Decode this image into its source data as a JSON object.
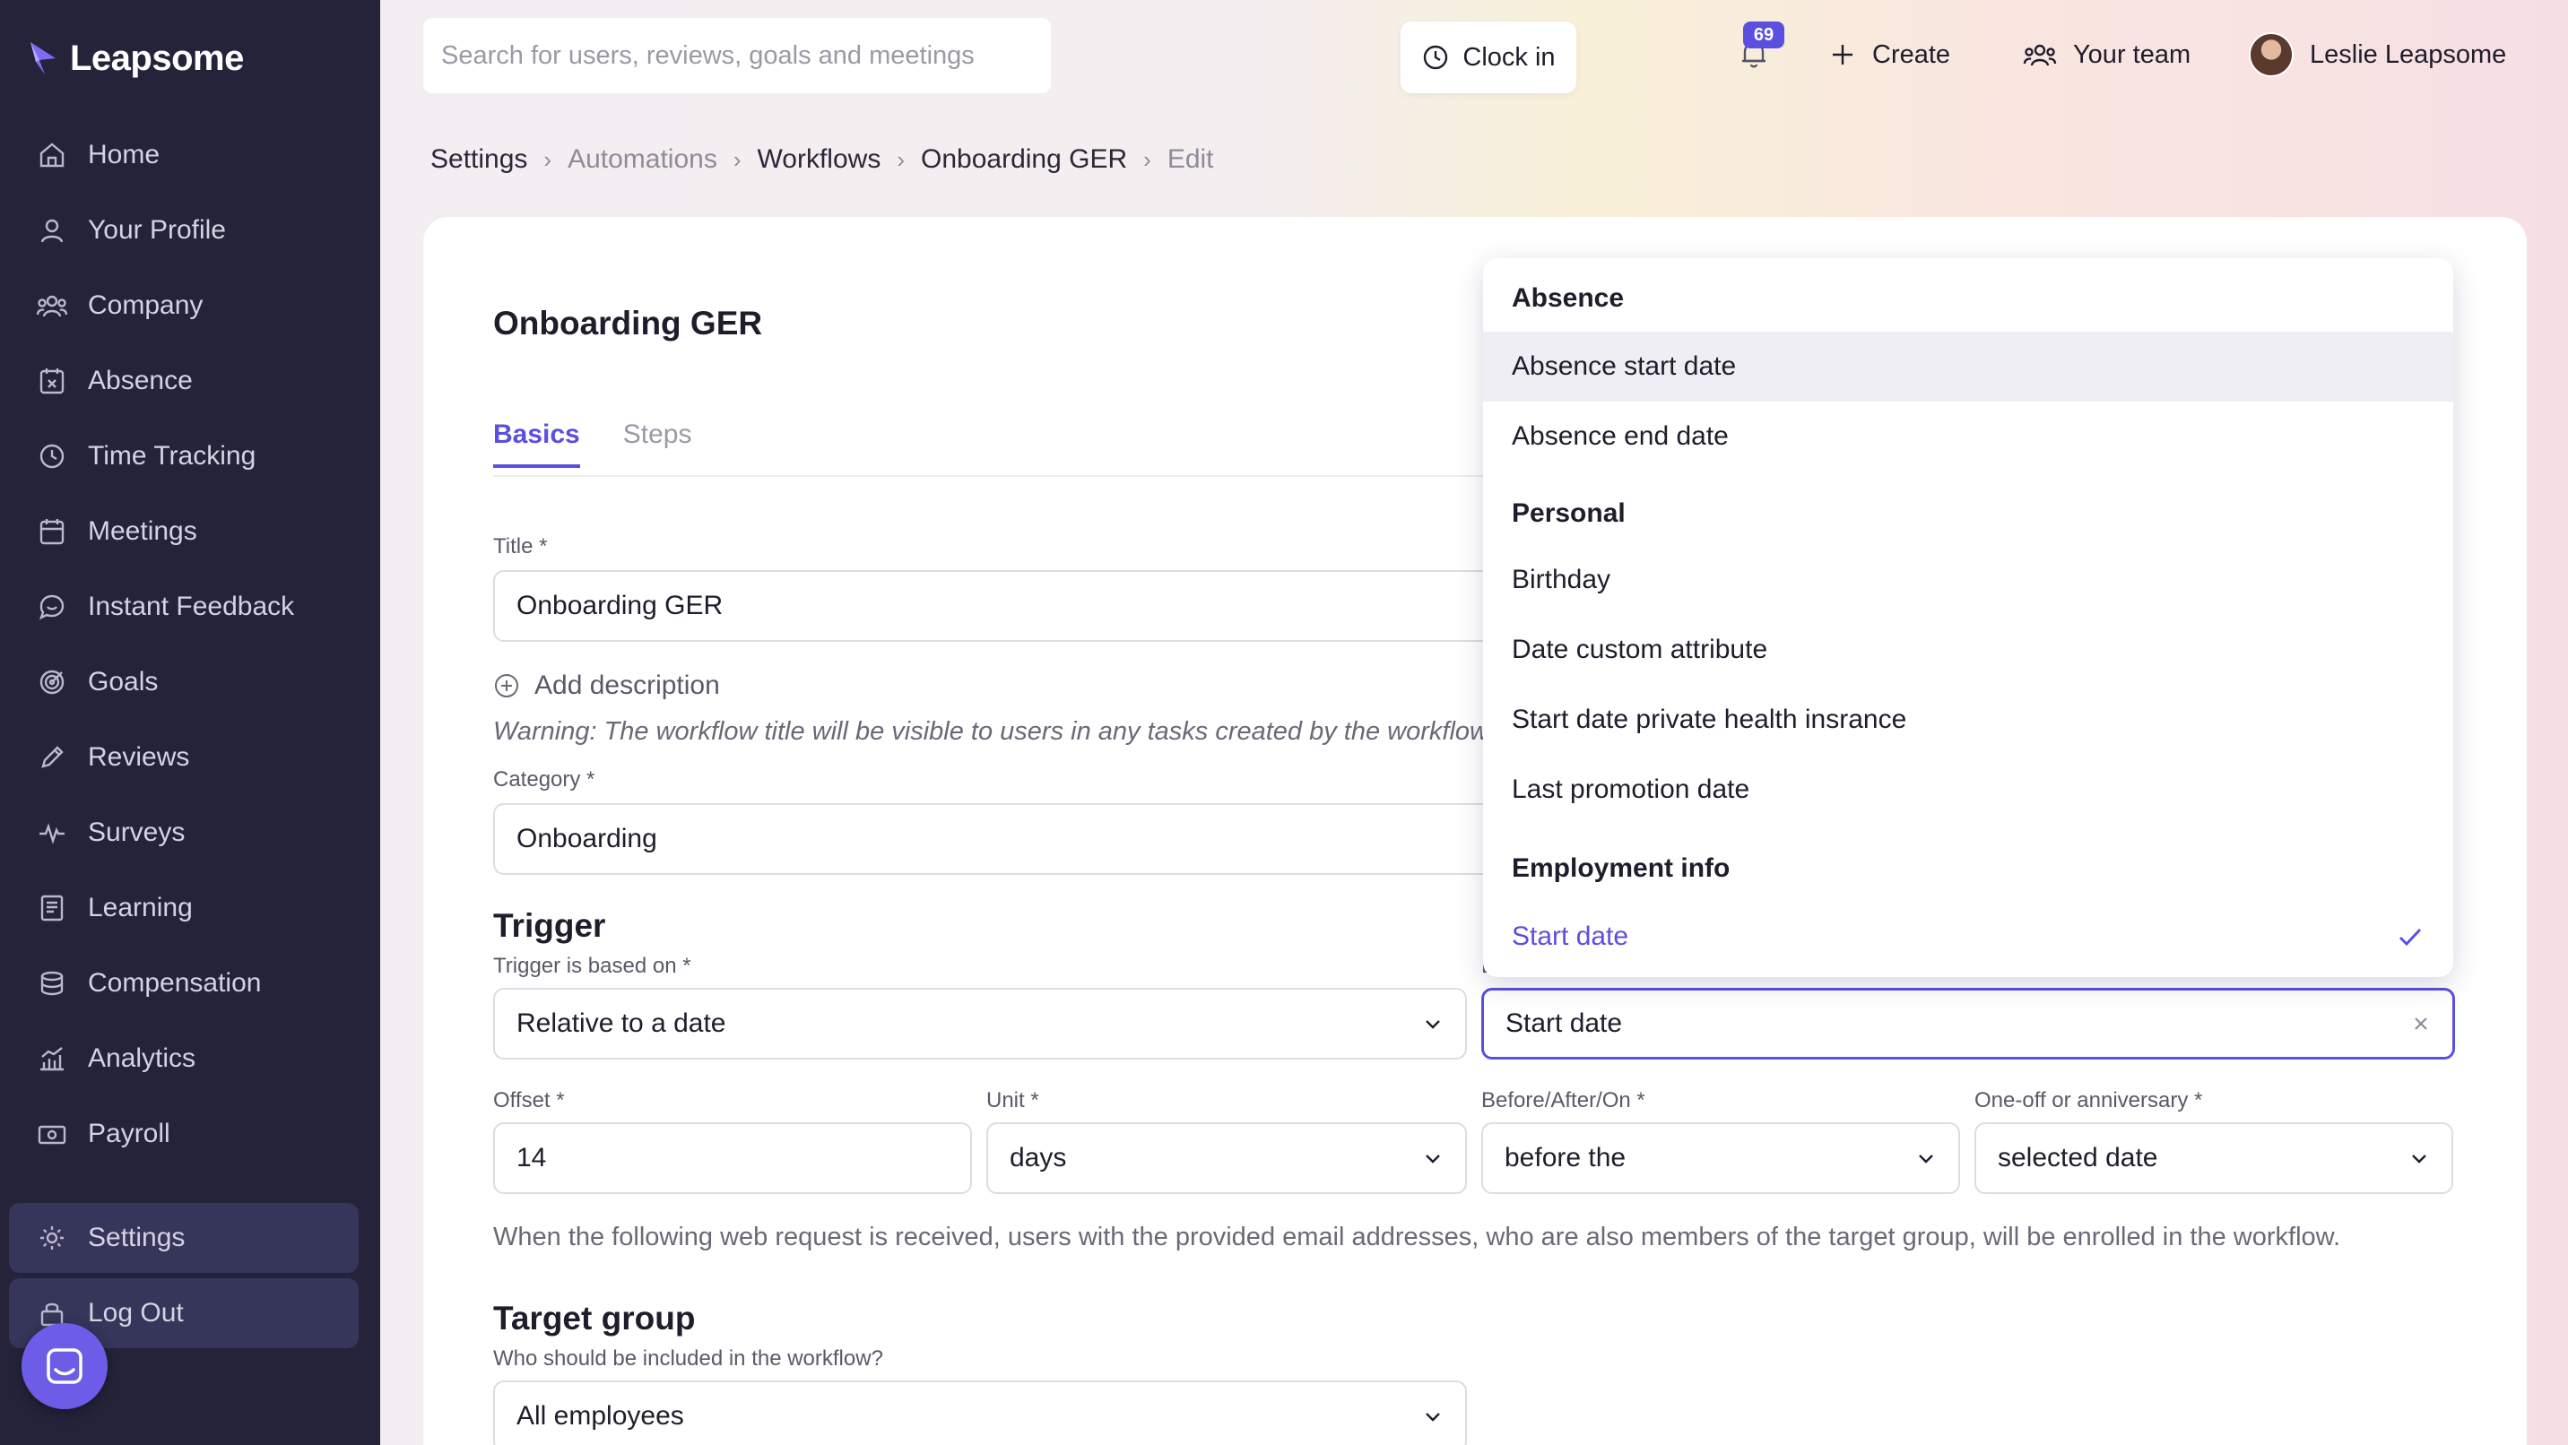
{
  "app": {
    "brand": "Leapsome"
  },
  "sidebar": {
    "items": [
      {
        "label": "Home",
        "icon": "home-icon"
      },
      {
        "label": "Your Profile",
        "icon": "user-icon"
      },
      {
        "label": "Company",
        "icon": "people-icon"
      },
      {
        "label": "Absence",
        "icon": "calendar-x-icon"
      },
      {
        "label": "Time Tracking",
        "icon": "clock-icon"
      },
      {
        "label": "Meetings",
        "icon": "calendar-icon"
      },
      {
        "label": "Instant Feedback",
        "icon": "chat-icon"
      },
      {
        "label": "Goals",
        "icon": "target-icon"
      },
      {
        "label": "Reviews",
        "icon": "pencil-icon"
      },
      {
        "label": "Surveys",
        "icon": "pulse-icon"
      },
      {
        "label": "Learning",
        "icon": "book-icon"
      },
      {
        "label": "Compensation",
        "icon": "coins-icon"
      },
      {
        "label": "Analytics",
        "icon": "chart-icon"
      },
      {
        "label": "Payroll",
        "icon": "cash-icon"
      }
    ],
    "bottom": [
      {
        "label": "Settings",
        "icon": "gear-icon"
      },
      {
        "label": "Log Out",
        "icon": "lock-icon"
      }
    ]
  },
  "topbar": {
    "search_placeholder": "Search for users, reviews, goals and meetings",
    "clock_in": "Clock in",
    "notifications_count": "69",
    "create": "Create",
    "your_team": "Your team",
    "user_name": "Leslie Leapsome"
  },
  "breadcrumb": [
    "Settings",
    "Automations",
    "Workflows",
    "Onboarding GER",
    "Edit"
  ],
  "page": {
    "title": "Onboarding GER",
    "tabs": [
      "Basics",
      "Steps"
    ],
    "title_label": "Title *",
    "title_value": "Onboarding GER",
    "add_description": "Add description",
    "warning": "Warning: The workflow title will be visible to users in any tasks created by the workflow.",
    "category_label": "Category *",
    "category_value": "Onboarding",
    "trigger_title": "Trigger",
    "trigger_label": "Trigger is based on *",
    "trigger_value": "Relative to a date",
    "date_field_label_fragment": "L",
    "date_value": "Start date",
    "offset_label": "Offset *",
    "offset_value": "14",
    "unit_label": "Unit *",
    "unit_value": "days",
    "before_after_label": "Before/After/On *",
    "before_after_value": "before the",
    "oneoff_label": "One-off or anniversary *",
    "oneoff_value": "selected date",
    "info_text": "When the following web request is received, users with the provided email addresses, who are also members of the target group, will be enrolled in the workflow.",
    "target_group_title": "Target group",
    "target_group_label": "Who should be included in the workflow?",
    "target_group_value": "All employees"
  },
  "dropdown": {
    "groups": [
      {
        "name": "Absence",
        "options": [
          "Absence start date",
          "Absence end date"
        ]
      },
      {
        "name": "Personal",
        "options": [
          "Birthday",
          "Date custom attribute",
          "Start date private health insrance",
          "Last promotion date"
        ]
      },
      {
        "name": "Employment info",
        "options": [
          "Start date"
        ]
      }
    ],
    "hovered": "Absence start date",
    "selected": "Start date"
  },
  "colors": {
    "accent": "#5b4fe0",
    "sidebar": "#24233a"
  }
}
